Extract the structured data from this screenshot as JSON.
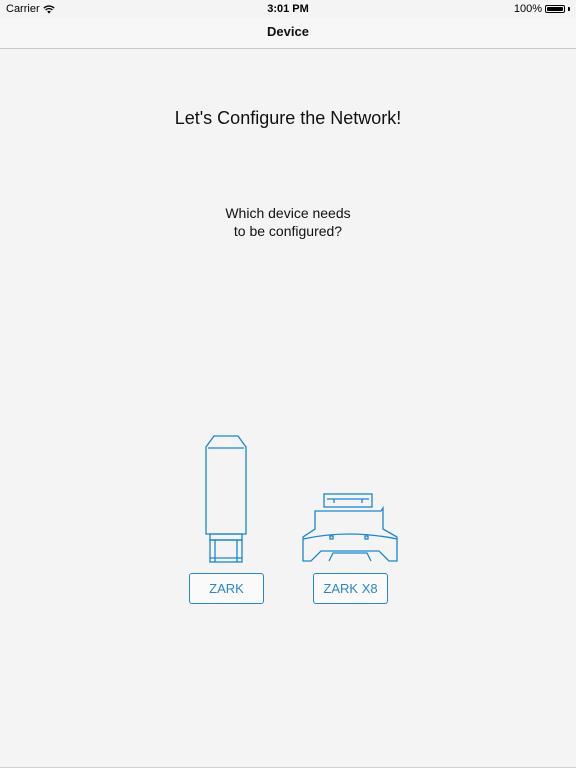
{
  "status": {
    "carrier": "Carrier",
    "time": "3:01 PM",
    "battery_text": "100%",
    "battery_level": 1.0
  },
  "nav": {
    "title": "Device"
  },
  "main": {
    "heading": "Let's Configure the Network!",
    "question_line1": "Which device needs",
    "question_line2": "to be configured?"
  },
  "devices": [
    {
      "label": "ZARK",
      "icon": "usb-dongle-icon"
    },
    {
      "label": "ZARK X8",
      "icon": "din-rail-module-icon"
    }
  ],
  "colors": {
    "accent": "#2a86c8",
    "background": "#f4f4f4"
  }
}
